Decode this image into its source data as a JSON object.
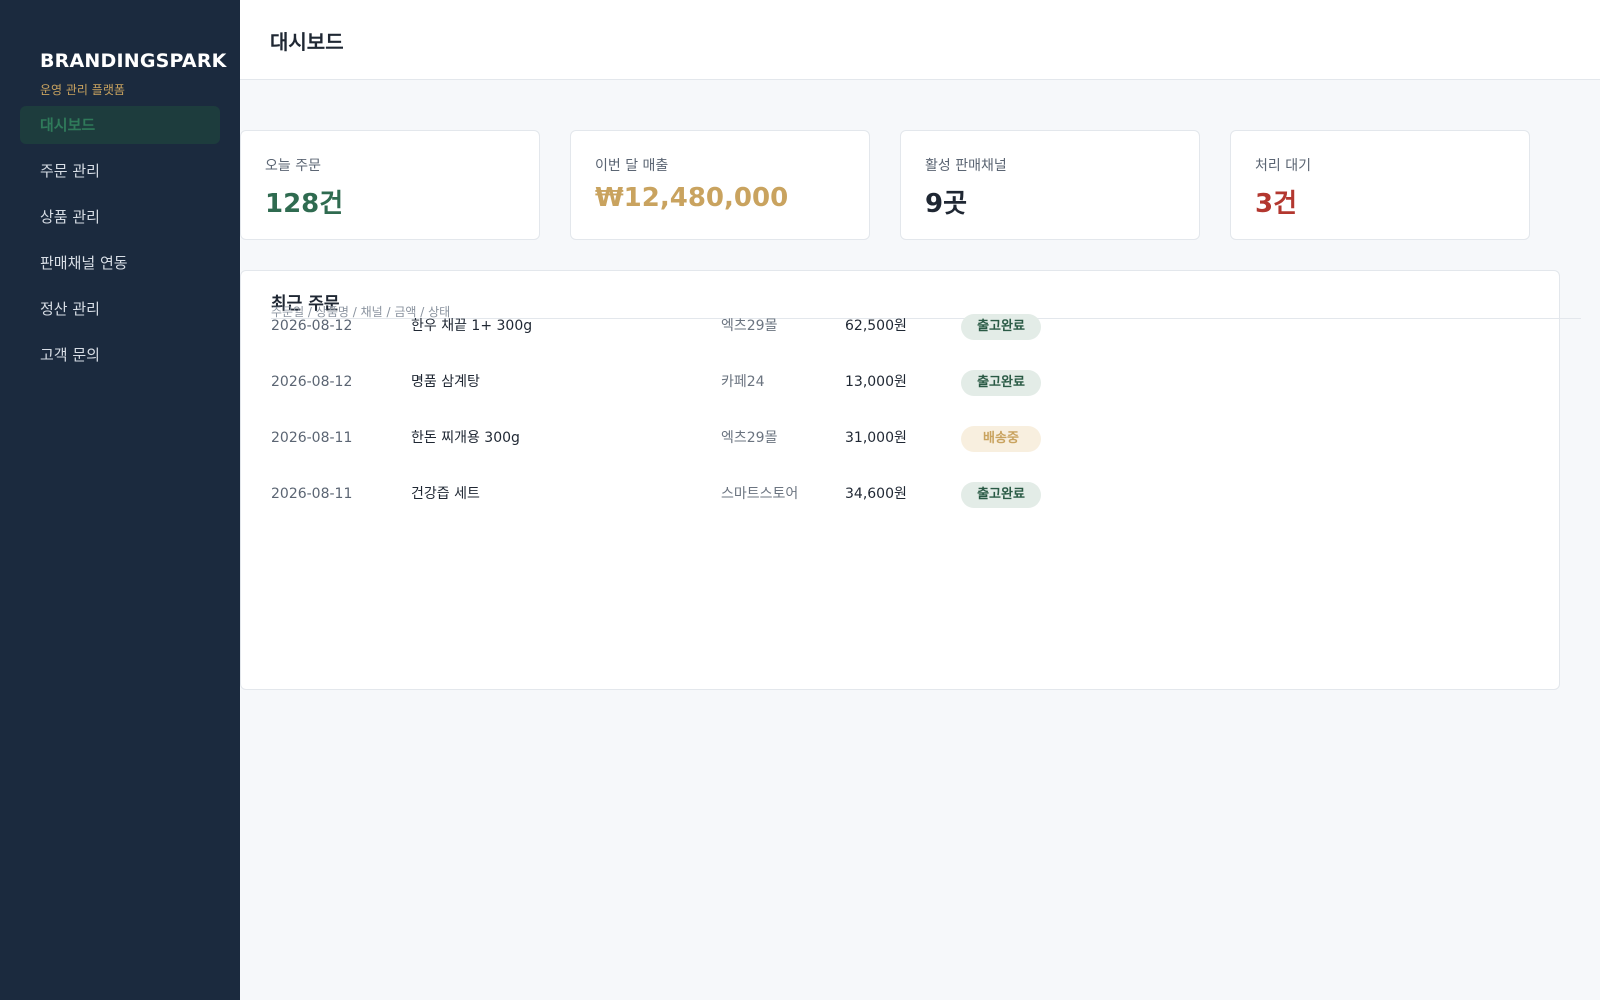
{
  "sidebar": {
    "brand": "BRANDINGSPARK",
    "brand_sub": "운영 관리 플랫폼",
    "items": [
      {
        "label": "대시보드",
        "active": true
      },
      {
        "label": "주문 관리"
      },
      {
        "label": "상품 관리"
      },
      {
        "label": "판매채널 연동"
      },
      {
        "label": "정산 관리"
      },
      {
        "label": "고객 문의"
      }
    ]
  },
  "header": {
    "title": "대시보드"
  },
  "stats": [
    {
      "label": "오늘 주문",
      "value": "128건",
      "color": "#2f6b50"
    },
    {
      "label": "이번 달 매출",
      "value": "₩12,480,000",
      "color": "#c9a35f"
    },
    {
      "label": "활성 판매채널",
      "value": "9곳",
      "color": "#1f2733"
    },
    {
      "label": "처리 대기",
      "value": "3건",
      "color": "#b3372f"
    }
  ],
  "orders": {
    "title": "최근 주문",
    "columns_text": "주문일 / 상품명 / 채널 / 금액 / 상태",
    "rows": [
      {
        "date": "2026-08-12",
        "name": "한우 채끝 1+ 300g",
        "channel": "엑츠29몰",
        "amount": "62,500원",
        "status": "출고완료"
      },
      {
        "date": "2026-08-12",
        "name": "명품 삼계탕",
        "channel": "카페24",
        "amount": "13,000원",
        "status": "출고완료"
      },
      {
        "date": "2026-08-11",
        "name": "한돈 찌개용 300g",
        "channel": "엑츠29몰",
        "amount": "31,000원",
        "status": "배송중"
      },
      {
        "date": "2026-08-11",
        "name": "건강즙 세트",
        "channel": "스마트스토어",
        "amount": "34,600원",
        "status": "출고완료"
      }
    ]
  },
  "colors": {
    "sidebar_bg": "#1b2a3e",
    "accent_green": "#2f7a5a",
    "accent_gold": "#c9a35f",
    "alert_red": "#b3372f"
  }
}
